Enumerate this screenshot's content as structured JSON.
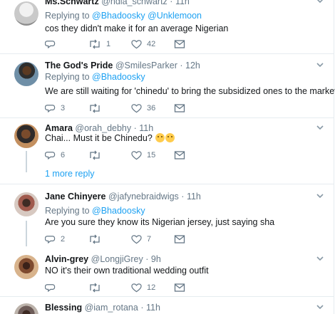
{
  "tweets": [
    {
      "name": "Ms.Schwartz",
      "handle": "@hdia_schwartz",
      "time": "11h",
      "replying_label": "Replying to",
      "replying_to": [
        "@Bhadoosky",
        "@Unklemoon"
      ],
      "text": "cos they didn't make it for an average Nigerian",
      "replies": "",
      "retweets": "1",
      "likes": "42"
    },
    {
      "name": "The God's Pride",
      "handle": "@SmilesParker",
      "time": "12h",
      "replying_label": "Replying to",
      "replying_to": [
        "@Bhadoosky"
      ],
      "text": "We are still waiting for 'chinedu' to bring the subsidized ones to the market",
      "replies": "3",
      "retweets": "",
      "likes": "36"
    },
    {
      "name": "Amara",
      "handle": "@orah_debhy",
      "time": "11h",
      "text": "Chai... Must it be Chinedu?",
      "replies": "6",
      "retweets": "",
      "likes": "15"
    },
    {
      "name": "Jane Chinyere",
      "handle": "@jafynebraidwigs",
      "time": "11h",
      "replying_label": "Replying to",
      "replying_to": [
        "@Bhadoosky"
      ],
      "text": "Are you sure they know its Nigerian jersey, just saying sha",
      "replies": "2",
      "retweets": "",
      "likes": "7"
    },
    {
      "name": "Alvin-grey",
      "handle": "@LongjiGrey",
      "time": "9h",
      "text": "NO it's their own traditional wedding outfit",
      "replies": "",
      "retweets": "",
      "likes": "12"
    },
    {
      "name": "Blessing",
      "handle": "@iam_rotana",
      "time": "11h"
    }
  ],
  "more_replies": "1 more reply",
  "colors": {
    "link": "#1da1f2",
    "muted": "#657786",
    "border": "#e6ecf0",
    "thread": "#ccd6dd"
  },
  "icons": [
    "reply-icon",
    "retweet-icon",
    "like-icon",
    "message-icon",
    "chevron-down-icon"
  ]
}
